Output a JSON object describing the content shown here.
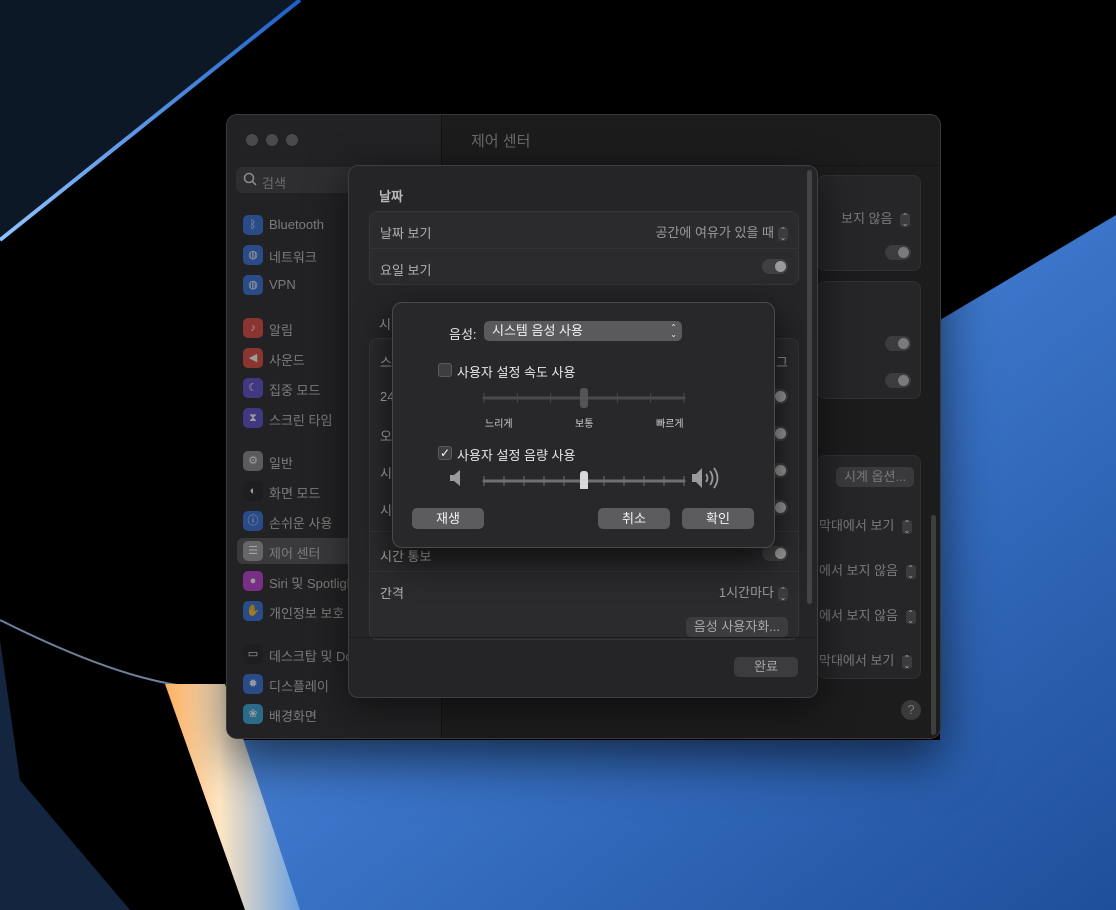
{
  "background": {
    "colors": {
      "dark": "#000000",
      "blue": "#3f7ed6",
      "glow": "#ffd7a0"
    }
  },
  "window": {
    "title": "제어 센터",
    "search_placeholder": "검색",
    "sidebar_items": [
      {
        "label": "Bluetooth",
        "icon": "bluetooth-icon",
        "color": "#2f6fdc"
      },
      {
        "label": "네트워크",
        "icon": "globe-icon",
        "color": "#2f6fdc"
      },
      {
        "label": "VPN",
        "icon": "vpn-icon",
        "color": "#2f6fdc"
      },
      {
        "label": "알림",
        "icon": "bell-icon",
        "color": "#e0463a"
      },
      {
        "label": "사운드",
        "icon": "speaker-icon",
        "color": "#e0463a"
      },
      {
        "label": "집중 모드",
        "icon": "moon-icon",
        "color": "#5b4bd0"
      },
      {
        "label": "스크린 타임",
        "icon": "hourglass-icon",
        "color": "#5b4bd0"
      },
      {
        "label": "일반",
        "icon": "gear-icon",
        "color": "#8a8a8e"
      },
      {
        "label": "화면 모드",
        "icon": "appearance-icon",
        "color": "#1c1c1e"
      },
      {
        "label": "손쉬운 사용",
        "icon": "accessibility-icon",
        "color": "#2f6fdc"
      },
      {
        "label": "제어 센터",
        "icon": "control-center-icon",
        "color": "#8a8a8e"
      },
      {
        "label": "Siri 및 Spotlight",
        "icon": "siri-icon",
        "color": "#c23ad6"
      },
      {
        "label": "개인정보 보호 및 보안",
        "icon": "hand-icon",
        "color": "#2f6fdc"
      },
      {
        "label": "데스크탑 및 Dock",
        "icon": "dock-icon",
        "color": "#1c1c1e"
      },
      {
        "label": "디스플레이",
        "icon": "sun-icon",
        "color": "#2f6fdc"
      },
      {
        "label": "배경화면",
        "icon": "flower-icon",
        "color": "#2fa8dc"
      }
    ],
    "main_items": [
      {
        "text": "보지 않음"
      },
      {
        "text": "시계 옵션..."
      },
      {
        "text": "막대에서 보기"
      },
      {
        "text": "에서 보지 않음"
      },
      {
        "text": "에서 보지 않음"
      },
      {
        "text": "막대에서 보기"
      }
    ],
    "help_label": "?"
  },
  "sheet": {
    "date_section": {
      "title": "날짜",
      "show_date_label": "날짜 보기",
      "show_date_value": "공간에 여유가 있을 때",
      "show_weekday_label": "요일 보기",
      "show_weekday_on": true
    },
    "partial_rows": {
      "section_title_fragment": "시",
      "row1_label": "스",
      "row1_value": "그",
      "row2_label": "24",
      "row3_label": "오",
      "row4_label": "시",
      "row5_label": "시"
    },
    "announce_row_label": "시간 통보",
    "interval_label": "간격",
    "interval_value": "1시간마다",
    "customize_voice_button": "음성 사용자화...",
    "done_button": "완료"
  },
  "dialog": {
    "voice_label": "음성:",
    "voice_value": "시스템 음성 사용",
    "custom_rate_label": "사용자 설정 속도 사용",
    "custom_rate_checked": false,
    "rate_ticks": [
      "느리게",
      "보통",
      "빠르게"
    ],
    "rate_value": 0.5,
    "custom_volume_label": "사용자 설정 음량 사용",
    "custom_volume_checked": true,
    "volume_value": 0.5,
    "play_button": "재생",
    "cancel_button": "취소",
    "ok_button": "확인"
  }
}
